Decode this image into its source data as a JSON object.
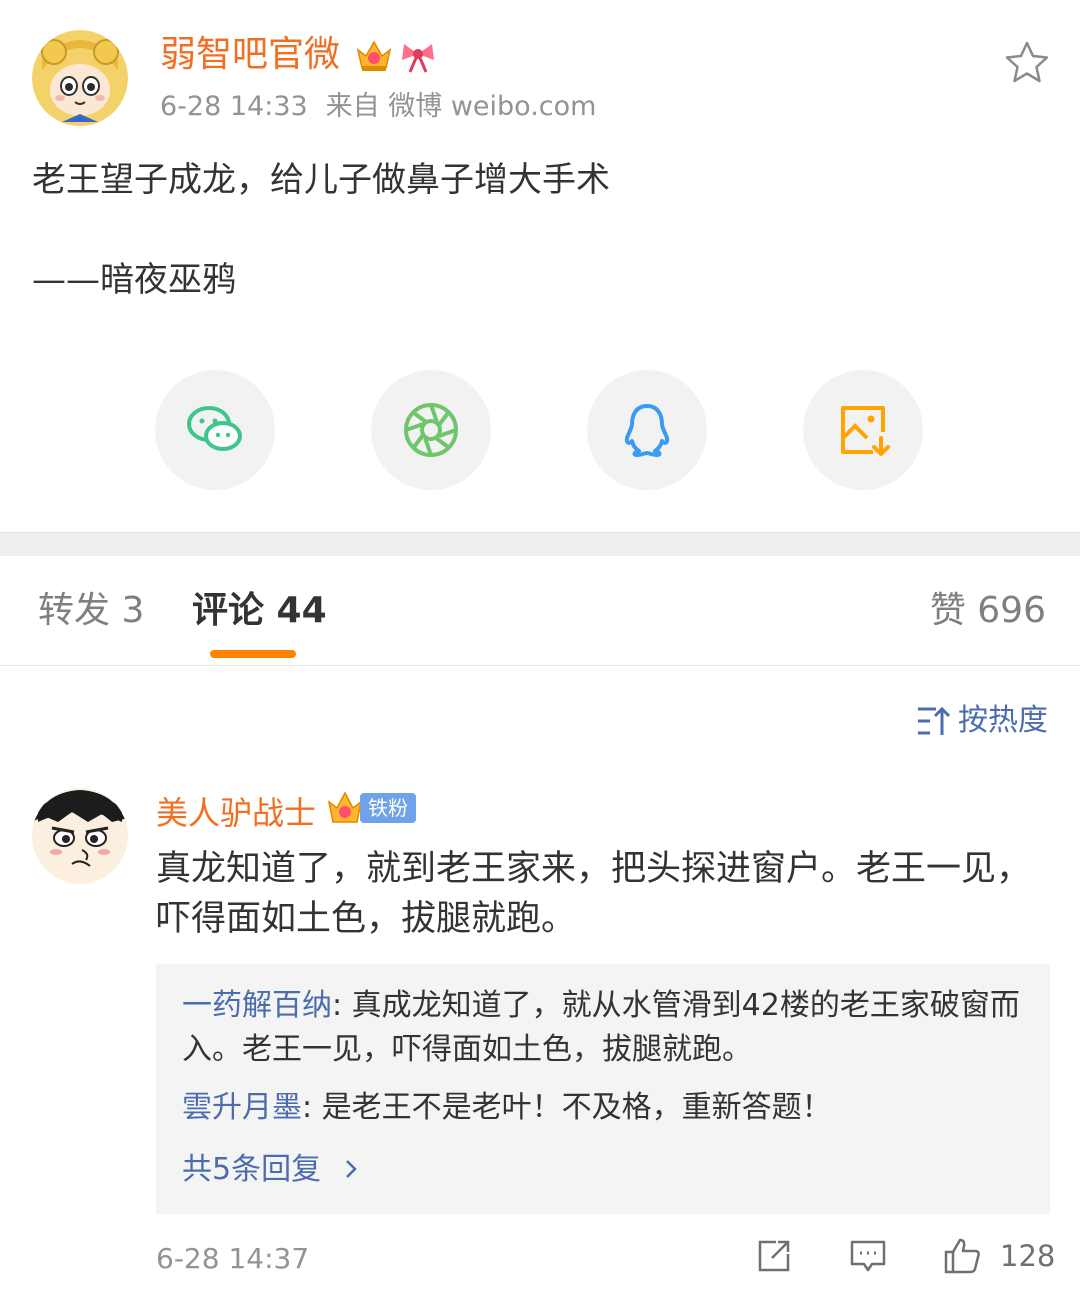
{
  "post": {
    "author": "弱智吧官微",
    "time": "6-28 14:33",
    "source": "来自 微博 weibo.com",
    "content": [
      "老王望子成龙，给儿子做鼻子增大手术",
      "——暗夜巫鸦"
    ]
  },
  "share": [
    {
      "icon": "wechat-icon",
      "color": "#3ec58a"
    },
    {
      "icon": "moments-icon",
      "color": "#6ec56b"
    },
    {
      "icon": "qq-icon",
      "color": "#3a9bf3"
    },
    {
      "icon": "save-image-icon",
      "color": "#ffa500"
    }
  ],
  "tabs": {
    "repost": "转发 3",
    "comment": "评论 44",
    "like": "赞 696"
  },
  "sort": {
    "label": "按热度"
  },
  "comment": {
    "user": "美人驴战士",
    "fan_badge": "铁粉",
    "text": "真龙知道了，就到老王家来，把头探进窗户。老王一见，吓得面如土色，拔腿就跑。",
    "replies": [
      {
        "user": "一药解百纳",
        "text": ": 真成龙知道了，就从水管滑到42楼的老王家破窗而入。老王一见，吓得面如土色，拔腿就跑。"
      },
      {
        "user": "雲升月墨",
        "text": ": 是老王不是老叶！不及格，重新答题！"
      }
    ],
    "more_replies": "共5条回复",
    "time": "6-28 14:37",
    "likes": "128"
  },
  "colors": {
    "accent": "#ff8200",
    "username": "#f26f21",
    "link": "#4b6cad",
    "muted": "#939393"
  }
}
